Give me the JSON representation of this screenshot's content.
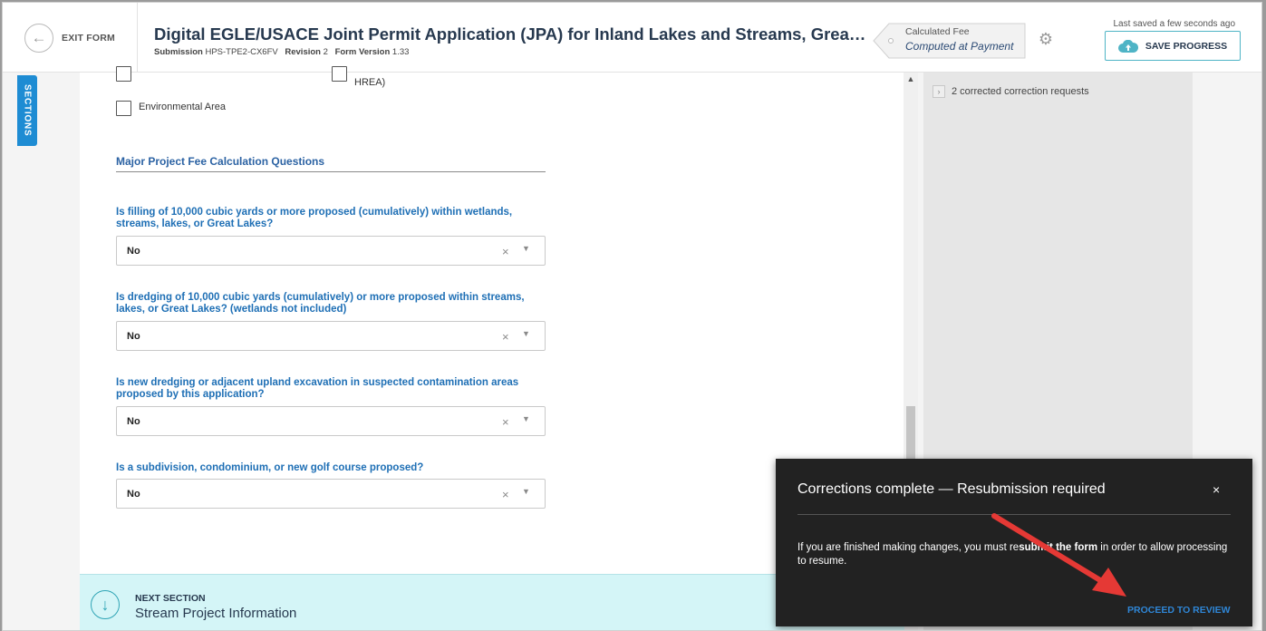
{
  "header": {
    "exit_label": "EXIT FORM",
    "title": "Digital EGLE/USACE Joint Permit Application (JPA) for Inland Lakes and Streams, Great Lakes, Wetlan...",
    "submission_label": "Submission",
    "submission_id": "HPS-TPE2-CX6FV",
    "revision_label": "Revision",
    "revision": "2",
    "form_version_label": "Form Version",
    "form_version": "1.33",
    "fee_label": "Calculated Fee",
    "fee_value": "Computed at Payment",
    "saved_status": "Last saved a few seconds ago",
    "save_label": "SAVE PROGRESS"
  },
  "sections_tab": "SECTIONS",
  "checkboxes": [
    {
      "label": "HREA)"
    },
    {
      "label": "Environmental Area"
    }
  ],
  "section_heading": "Major Project Fee Calculation Questions",
  "questions": [
    {
      "text": "Is filling of 10,000 cubic yards or more proposed (cumulatively) within wetlands, streams, lakes, or Great Lakes?",
      "value": "No"
    },
    {
      "text": "Is dredging of 10,000 cubic yards (cumulatively) or more proposed within streams, lakes, or Great Lakes? (wetlands not included)",
      "value": "No"
    },
    {
      "text": "Is new dredging or adjacent upland excavation in suspected contamination areas proposed by this application?",
      "value": "No"
    },
    {
      "text": "Is a subdivision, condominium, or new golf course proposed?",
      "value": "No"
    }
  ],
  "next_section": {
    "label": "NEXT SECTION",
    "title": "Stream Project Information"
  },
  "right_panel": {
    "item": "2 corrected correction requests"
  },
  "toast": {
    "title": "Corrections complete — Resubmission required",
    "close": "×",
    "body_pre": "If you are finished making changes, you must re",
    "body_bold": "submit the form",
    "body_post": " in order to allow processing to resume.",
    "link": "PROCEED TO REVIEW"
  },
  "colors": {
    "accent": "#1e8cd3",
    "question_blue": "#1e6fb5",
    "next_bg": "#d4f5f7",
    "toast_bg": "#222222",
    "annotation_arrow": "#e53935"
  }
}
